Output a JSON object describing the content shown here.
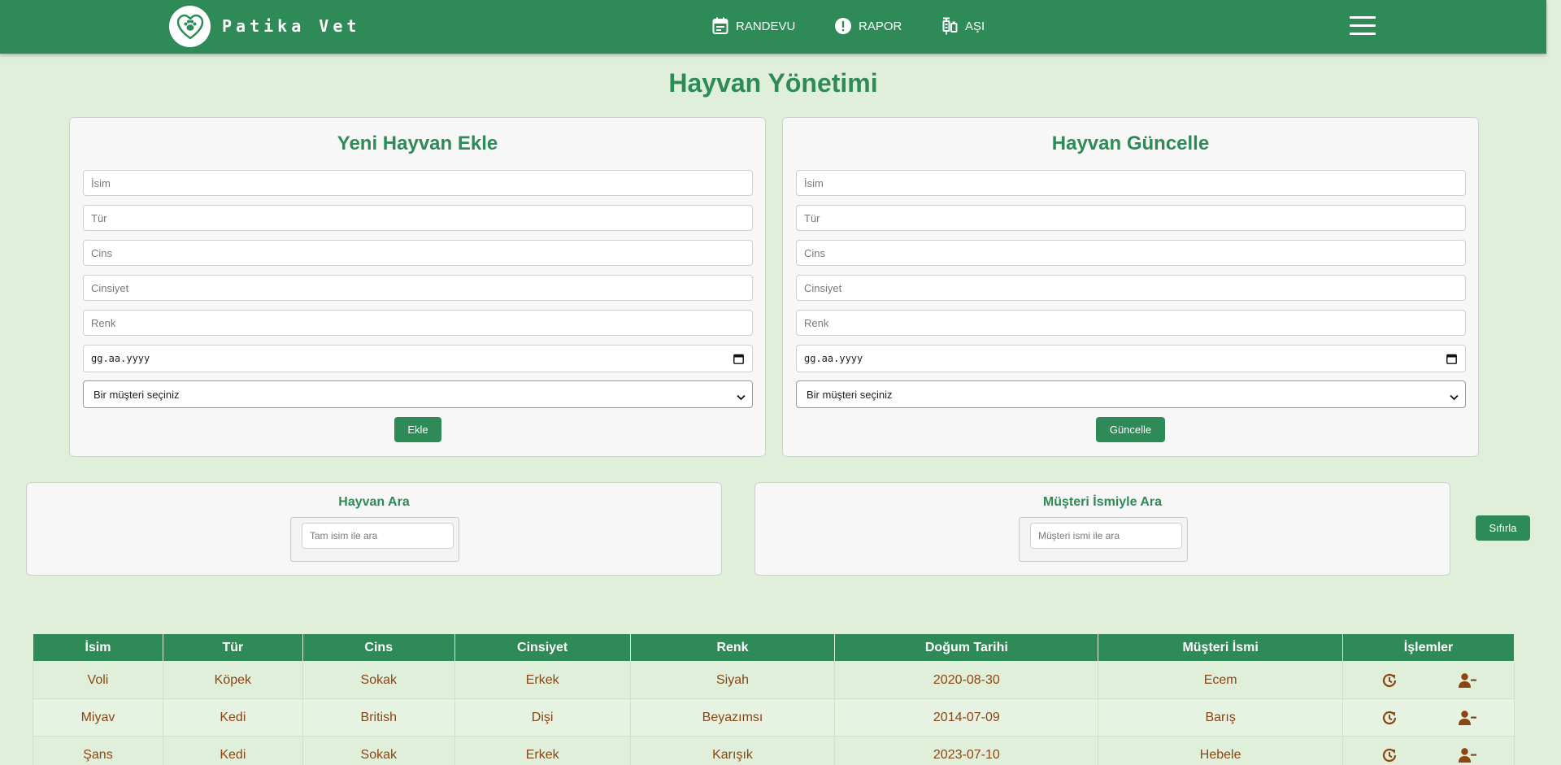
{
  "navbar": {
    "brand": "Patika Vet",
    "links": [
      {
        "label": "RANDEVU",
        "icon": "calendar-icon"
      },
      {
        "label": "RAPOR",
        "icon": "alert-circle-icon"
      },
      {
        "label": "AŞI",
        "icon": "syringe-icon"
      }
    ],
    "menu_icon": "hamburger-menu-icon",
    "logo_icon": "paw-heart-logo-icon"
  },
  "page": {
    "title": "Hayvan Yönetimi"
  },
  "add_form": {
    "title": "Yeni Hayvan Ekle",
    "placeholders": {
      "name": "İsim",
      "species": "Tür",
      "breed": "Cins",
      "gender": "Cinsiyet",
      "color": "Renk"
    },
    "date_placeholder": "gg.aa.yyyy",
    "select_value": "Bir müşteri seçiniz",
    "button_label": "Ekle"
  },
  "update_form": {
    "title": "Hayvan Güncelle",
    "placeholders": {
      "name": "İsim",
      "species": "Tür",
      "breed": "Cins",
      "gender": "Cinsiyet",
      "color": "Renk"
    },
    "date_placeholder": "gg.aa.yyyy",
    "select_value": "Bir müşteri seçiniz",
    "button_label": "Güncelle"
  },
  "search_animal": {
    "title": "Hayvan Ara",
    "placeholder": "Tam isim ile ara"
  },
  "search_customer": {
    "title": "Müşteri İsmiyle Ara",
    "placeholder": "Müşteri ismi ile ara"
  },
  "reset_button": "Sıfırla",
  "table": {
    "headers": [
      "İsim",
      "Tür",
      "Cins",
      "Cinsiyet",
      "Renk",
      "Doğum Tarihi",
      "Müşteri İsmi",
      "İşlemler"
    ],
    "rows": [
      [
        "Voli",
        "Köpek",
        "Sokak",
        "Erkek",
        "Siyah",
        "2020-08-30",
        "Ecem"
      ],
      [
        "Miyav",
        "Kedi",
        "British",
        "Dişi",
        "Beyazımsı",
        "2014-07-09",
        "Barış"
      ],
      [
        "Şans",
        "Kedi",
        "Sokak",
        "Erkek",
        "Karışık",
        "2023-07-10",
        "Hebele"
      ]
    ],
    "action_icons": [
      "history-update-icon",
      "remove-user-icon"
    ]
  },
  "colors": {
    "primary": "#2e8b57",
    "background": "#dfefd9",
    "cell_text": "#8b4513",
    "panel": "#f7f7f7"
  }
}
